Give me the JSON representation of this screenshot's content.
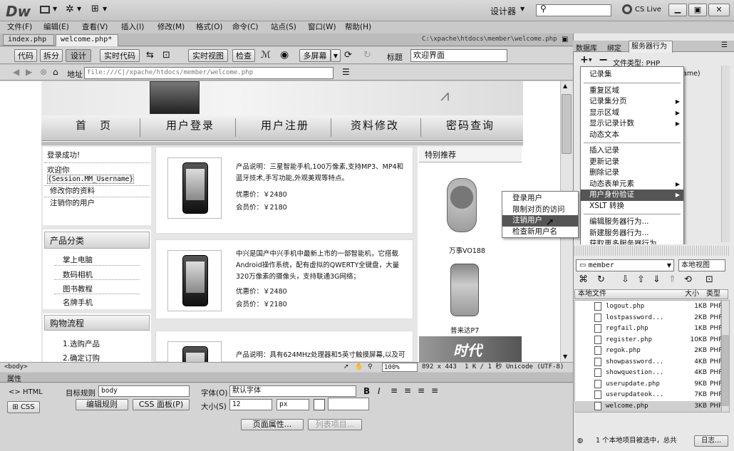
{
  "app": {
    "logo": "Dw",
    "workspace": "设计器",
    "cs_live": "CS Live"
  },
  "menubar": [
    "文件(F)",
    "编辑(E)",
    "查看(V)",
    "插入(I)",
    "修改(M)",
    "格式(O)",
    "命令(C)",
    "站点(S)",
    "窗口(W)",
    "帮助(H)"
  ],
  "tabs": [
    {
      "label": "index.php"
    },
    {
      "label": "welcome.php*"
    }
  ],
  "doc_path": "C:\\xpache\\htdocs\\member\\welcome.php",
  "toolbar": {
    "code": "代码",
    "split": "拆分",
    "design": "设计",
    "live_code": "实时代码",
    "live_view": "实时视图",
    "inspect": "检查",
    "multiscreen": "多屏幕",
    "title_label": "标题",
    "title_value": "欢迎界面"
  },
  "addressbar": {
    "label": "地址",
    "url": "file:///C|/xpache/htdocs/member/welcome.php"
  },
  "page": {
    "nav": [
      "首　页",
      "用户登录",
      "用户注册",
      "资料修改",
      "密码查询"
    ],
    "login": {
      "title": "登录成功!",
      "welcome": "欢迎你",
      "session": "{Session.MM_Username}",
      "links": [
        "修改你的资料",
        "注销你的用户"
      ]
    },
    "category": {
      "title": "产品分类",
      "items": [
        "掌上电脑",
        "数码相机",
        "图书教程",
        "名牌手机"
      ]
    },
    "flow": {
      "title": "购物流程",
      "items": [
        "1.选购产品",
        "2.确定订购"
      ]
    },
    "products": [
      {
        "desc": "产品说明：三星智能手机,100万像素,支持MP3、MP4和蓝牙技术,手写功能,外观美观等特点。",
        "price_label": "优惠价：",
        "price": "￥2480",
        "member_label": "会员价：",
        "member_price": "￥2180"
      },
      {
        "desc": "中兴是国产中兴手机中最新上市的一部智能机，它搭载Android操作系统，配有虚拟的QWERTY全键盘，大量320万像素的摄像头，支持联通3G网络；",
        "price_label": "优惠价：",
        "price": "￥2480",
        "member_label": "会员价：",
        "member_price": "￥2180"
      },
      {
        "desc": "产品说明：具有624MHz处理器和5英寸触摸屏幕,以及可"
      }
    ],
    "special": {
      "title": "特别推荐",
      "items": [
        {
          "name": "万事VO188"
        },
        {
          "name": "普来达P7"
        }
      ]
    },
    "banner_text": "时代"
  },
  "statusbar": {
    "tag": "<body>",
    "zoom": "100%",
    "size": "892 x 443",
    "info": "1 K / 1 秒",
    "encoding": "Unicode (UTF-8)"
  },
  "properties": {
    "title": "属性",
    "html": "HTML",
    "css": "CSS",
    "target_rule_label": "目标规则",
    "target_rule": "body",
    "edit_rule": "编辑规则",
    "css_panel": "CSS 面板(P)",
    "font_label": "字体(O)",
    "font_value": "默认字体",
    "size_label": "大小(S)",
    "size_value": "12",
    "unit": "px",
    "page_props": "页面属性...",
    "list_item": "列表项目..."
  },
  "right_panel": {
    "tabs": [
      "数据库",
      "绑定",
      "服务器行为"
    ],
    "doc_type_label": "文件类型: PHP",
    "hidden_text": "ame)"
  },
  "server_menu": {
    "items": [
      {
        "label": "记录集"
      },
      {
        "sep": true
      },
      {
        "label": "重复区域"
      },
      {
        "label": "记录集分页",
        "sub": true
      },
      {
        "label": "显示区域",
        "sub": true
      },
      {
        "label": "显示记录计数",
        "sub": true
      },
      {
        "label": "动态文本"
      },
      {
        "sep": true
      },
      {
        "label": "插入记录"
      },
      {
        "label": "更新记录"
      },
      {
        "label": "删除记录"
      },
      {
        "label": "动态表单元素",
        "sub": true
      },
      {
        "label": "用户身份验证",
        "sub": true,
        "active": true
      },
      {
        "label": "XSLT 转换"
      },
      {
        "sep": true
      },
      {
        "label": "编辑服务器行为..."
      },
      {
        "label": "新建服务器行为..."
      },
      {
        "label": "获取更多服务器行为..."
      }
    ]
  },
  "auth_submenu": [
    "登录用户",
    "限制对页的访问",
    "注销用户",
    "检查新用户名"
  ],
  "files": {
    "site": "member",
    "view": "本地视图",
    "headers": [
      "本地文件",
      "大小",
      "类型"
    ],
    "rows": [
      {
        "name": "logout.php",
        "size": "1KB",
        "type": "PHP"
      },
      {
        "name": "lostpassword...",
        "size": "2KB",
        "type": "PHP"
      },
      {
        "name": "regfail.php",
        "size": "1KB",
        "type": "PHP"
      },
      {
        "name": "register.php",
        "size": "10KB",
        "type": "PHP"
      },
      {
        "name": "regok.php",
        "size": "2KB",
        "type": "PHP"
      },
      {
        "name": "showpassword...",
        "size": "4KB",
        "type": "PHP"
      },
      {
        "name": "showquestion...",
        "size": "4KB",
        "type": "PHP"
      },
      {
        "name": "userupdate.php",
        "size": "9KB",
        "type": "PHP"
      },
      {
        "name": "userupdateok...",
        "size": "7KB",
        "type": "PHP"
      },
      {
        "name": "welcome.php",
        "size": "3KB",
        "type": "PHP"
      }
    ],
    "status": "1 个本地项目被选中，总共",
    "log": "日志..."
  }
}
